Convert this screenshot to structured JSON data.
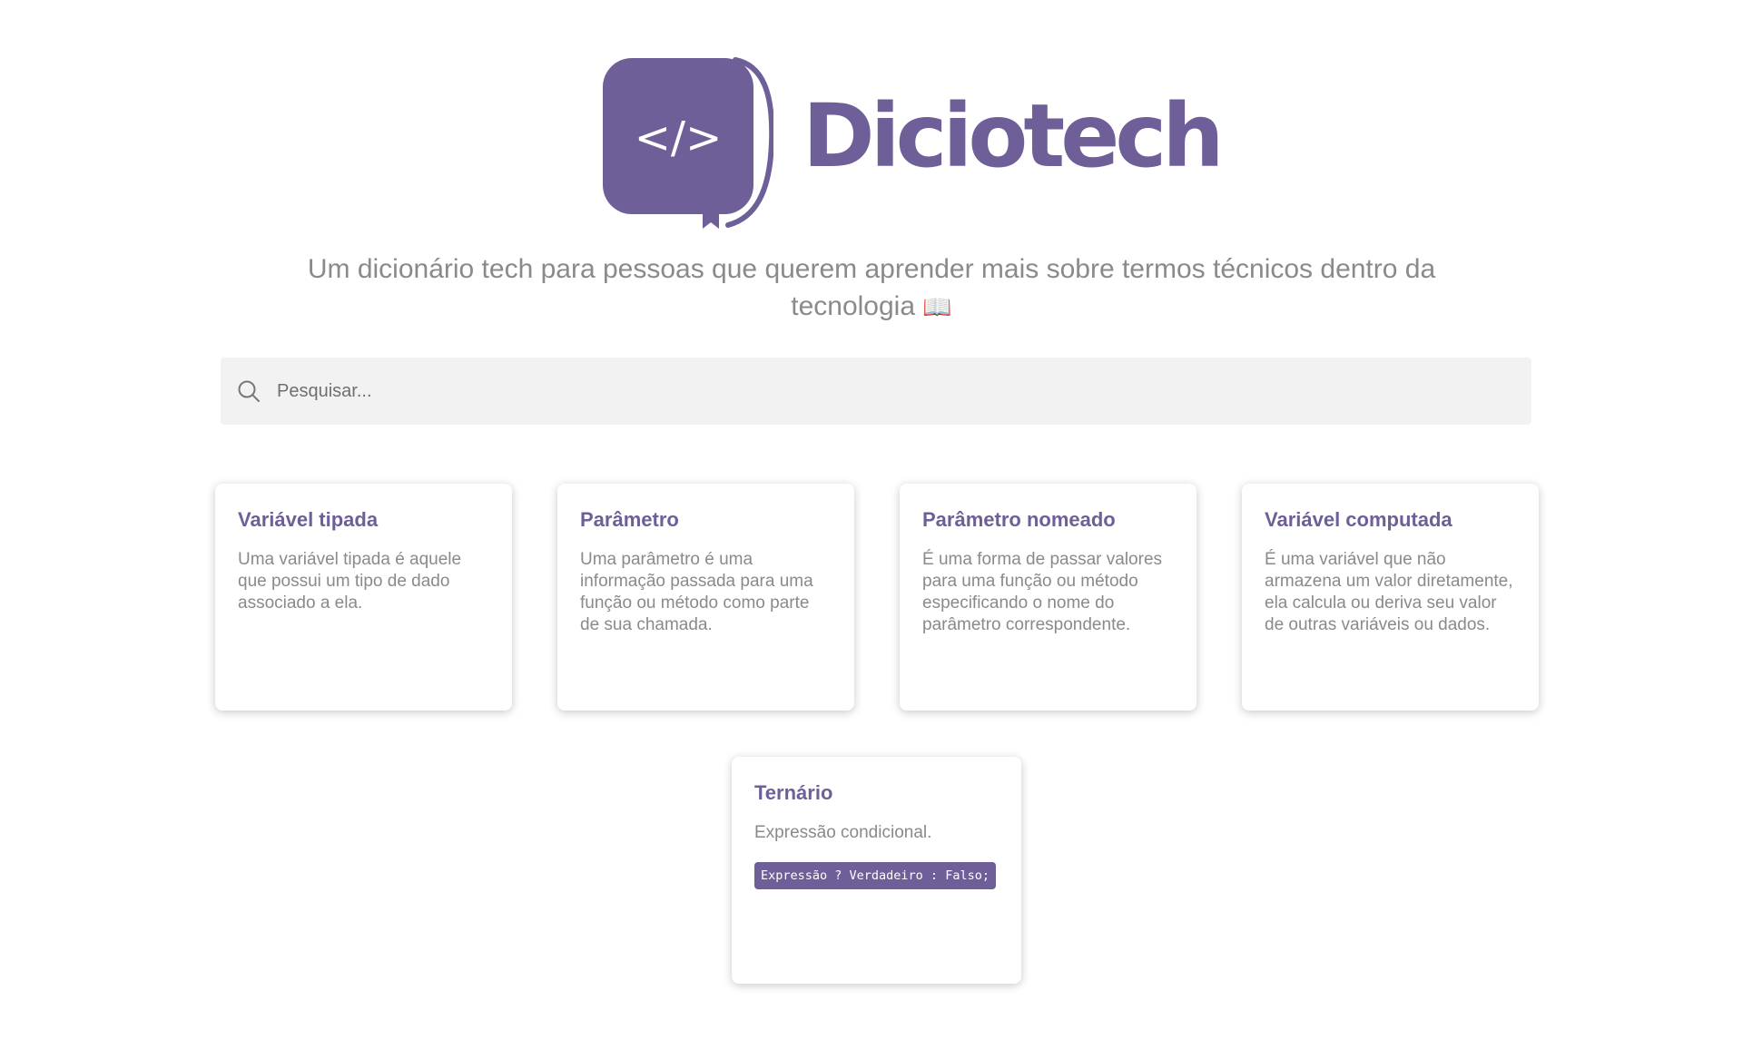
{
  "header": {
    "logo_text": "Diciotech",
    "tagline": "Um dicionário tech para pessoas que querem aprender mais sobre termos técnicos dentro da tecnologia",
    "tagline_emoji": "📖"
  },
  "search": {
    "placeholder": "Pesquisar...",
    "value": ""
  },
  "cards": [
    {
      "title": "Variável tipada",
      "description": "Uma variável tipada é aquele que possui um tipo de dado associado a ela."
    },
    {
      "title": "Parâmetro",
      "description": "Uma parâmetro é uma informação passada para uma função ou método como parte de sua chamada."
    },
    {
      "title": "Parâmetro nomeado",
      "description": "É uma forma de passar valores para uma função ou método especificando o nome do parâmetro correspondente."
    },
    {
      "title": "Variável computada",
      "description": "É uma variável que não armazena um valor diretamente, ela calcula ou deriva seu valor de outras variáveis ou dados."
    },
    {
      "title": "Ternário",
      "description": "Expressão condicional.",
      "code": "Expressão ? Verdadeiro : Falso;"
    }
  ],
  "colors": {
    "brand": "#6e5f98",
    "text_muted": "#8a8a8a",
    "search_bg": "#f2f2f2"
  },
  "icons": {
    "logo": "code-book-speech-bubble-icon",
    "search": "magnifier-icon",
    "tagline": "open-book-emoji"
  }
}
